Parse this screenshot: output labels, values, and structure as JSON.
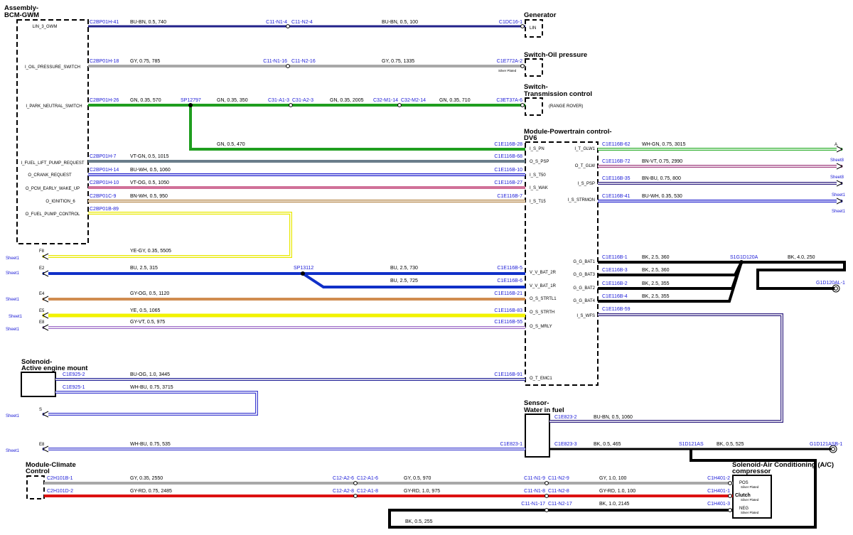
{
  "colors": {
    "BU-BN": "#22228a",
    "GY": "#a8a8a8",
    "GN": "#1f9e1f",
    "VT-GN": "#6a7d8a",
    "BU-WH": "#1a1acc",
    "VT-OG": "#d07098",
    "BN-WH": "#b08040",
    "YE-GY": "#e8e800",
    "BU": "#1030c8",
    "GY-OG": "#d08c50",
    "YE": "#f2f200",
    "GY-VT": "#a070c8",
    "BU-OG": "#2a2a9a",
    "WH-BU": "#4040d0",
    "GY-RD": "#dd1111",
    "BK": "#000000",
    "WH-GN": "#30b030",
    "BN-VT": "#a04080",
    "BN-BU": "#302080"
  },
  "components": {
    "bcm": "Assembly-\nBCM-GWM",
    "generator": "Generator",
    "oil": "Switch-Oil pressure",
    "trans": "Switch-\nTransmission control",
    "trans_note": "(RANGE ROVER)",
    "pcm": "Module-Powertrain control-\nDV6",
    "solenoid_mount": "Solenoid-\nActive engine mount",
    "sensor_wif": "Sensor-\nWater in fuel",
    "climate": "Module-Climate\nControl",
    "ac": "Solenoid-Air Conditioning (A/C)\ncompressor"
  },
  "bcm_pins": [
    "LIN_3_GWM",
    "I_OIL_PRESSURE_SWITCH",
    "I_PARK_NEUTRAL_SWITCH",
    "I_FUEL_LIFT_PUMP_REQUEST",
    "O_CRANK_REQUEST",
    "O_PCM_EARLY_WAKE_UP",
    "O_IGNITION_6",
    "O_FUEL_PUMP_CONTROL"
  ],
  "pcm_pins_left": [
    "I_S_PN",
    "O_S_PSP",
    "I_S_T50",
    "I_S_WAK",
    "I_S_T15",
    "V_V_BAT_2R",
    "V_V_BAT_1R",
    "O_S_STRTL1",
    "O_S_STRTH",
    "O_S_MRLY",
    "O_T_EMC1"
  ],
  "pcm_pins_right": [
    "I_T_GLW1",
    "O_T_GLW",
    "I_S_PSP",
    "I_S_STRMON",
    "G_G_BAT1",
    "G_G_BAT3",
    "G_G_BAT2",
    "G_G_BAT4",
    "I_S_WFS"
  ],
  "generator_pin": "LIN",
  "silver_plated": "Silver Plated",
  "ac_pins": [
    "POS",
    "Clutch",
    "NEG"
  ],
  "connectors": {
    "c1": "C2BP01H-41",
    "c2": "C11-N1-4",
    "c3": "C11-N2-4",
    "c4": "C1DC16-1",
    "c5": "C2BP01H-18",
    "c6": "C11-N1-16",
    "c7": "C11-N2-16",
    "c8": "C1E772A-2",
    "c9": "C2BP01H-26",
    "c10": "SP12797",
    "c11": "C31-A1-3",
    "c12": "C31-A2-3",
    "c13": "C32-M1-14",
    "c14": "C32-M2-14",
    "c15": "C3ET37A-6",
    "c16": "C1E116B-28",
    "c17": "C2BP01H-7",
    "c18": "C1E116B-68",
    "c19": "C2BP01H-14",
    "c20": "C1E116B-10",
    "c21": "C2BP01H-10",
    "c22": "C1E116B-27",
    "c23": "C2BP01C-9",
    "c24": "C1E116B-7",
    "c25": "C2BP01B-89",
    "c26": "SP13112",
    "c27": "C1E116B-5",
    "c28": "C1E116B-6",
    "c29": "C1E116B-21",
    "c30": "C1E116B-83",
    "c31": "C1E116B-55",
    "c32": "C1E925-2",
    "c33": "C1E116B-91",
    "c34": "C1E925-1",
    "c35": "C1E823-1",
    "c36": "C1E823-2",
    "c37": "C1E823-3",
    "c38": "S1D121AS",
    "c39": "G1D121ASB-1",
    "c40": "C1E116B-62",
    "c41": "C1E116B-72",
    "c42": "C1E116B-35",
    "c43": "C1E116B-41",
    "c44": "C1E116B-1",
    "c45": "C1E116B-3",
    "c46": "C1E116B-2",
    "c47": "C1E116B-4",
    "c48": "S1G1D120A",
    "c49": "G1D120AL-1",
    "c50": "C1E116B-59",
    "c51": "C2H101B-1",
    "c52": "C12-A2-6",
    "c53": "C12-A1-6",
    "c54": "C11-N1-9",
    "c55": "C11-N2-9",
    "c56": "C1H401-2",
    "c57": "C2H101D-2",
    "c58": "C12-A2-8",
    "c59": "C12-A1-8",
    "c60": "C11-N1-8",
    "c61": "C11-N2-8",
    "c62": "C1H401-1",
    "c63": "C11-N1-17",
    "c64": "C11-N2-17",
    "c65": "C1H401-3"
  },
  "wires": {
    "w1a": "BU-BN,  0.5,  740",
    "w1b": "BU-BN,  0.5,  100",
    "w2a": "GY,  0.75,  785",
    "w2b": "GY,  0.75,  1335",
    "w3a": "GN,  0.35,  570",
    "w3b": "GN,  0.35,  350",
    "w3c": "GN,  0.35,  2005",
    "w3d": "GN,  0.35,  710",
    "w3e": "GN,  0.5,  470",
    "w4": "VT-GN,  0.5,  1015",
    "w5": "BU-WH,  0.5,  1060",
    "w6": "VT-OG,  0.5,  1050",
    "w7": "BN-WH,  0.5,  950",
    "w8": "YE-GY,  0.35,  5505",
    "w9a": "BU,  2.5,  315",
    "w9b": "BU,  2.5,  730",
    "w9c": "BU,  2.5,  725",
    "w10": "GY-OG,  0.5,  1120",
    "w11": "YE,  0.5,  1065",
    "w12": "GY-VT,  0.5,  975",
    "w13": "BU-OG,  1.0,  3445",
    "w14": "WH-BU,  0.75,  3715",
    "w15": "WH-BU,  0.75,  535",
    "w16": "BU-BN,  0.5,  1060",
    "w17": "BK,  0.5,  465",
    "w18": "BK,  0.5,  525",
    "w19": "WH-GN,  0.75,  3015",
    "w20": "BN-VT,  0.75,  2990",
    "w21": "BN-BU,  0.75,  800",
    "w22": "BU-WH,  0.35,  530",
    "w23": "BK,  2.5,  360",
    "w24": "BK,  2.5,  360",
    "w25": "BK,  2.5,  355",
    "w26": "BK,  2.5,  355",
    "w27": "BK,  4.0,  250",
    "w28a": "GY,  0.35,  2550",
    "w28b": "GY,  0.5,  970",
    "w28c": "GY,  1.0,  100",
    "w29a": "GY-RD,  0.75,  2485",
    "w29b": "GY-RD,  1.0,  975",
    "w29c": "GY-RD,  1.0,  100",
    "w30": "BK,  1.0,  2145",
    "w31": "BK,  0.5,  255"
  },
  "edge_labels": [
    "F8",
    "E2",
    "E4",
    "E5",
    "E8",
    "S",
    "E8"
  ],
  "sheet_label": "Sheet1",
  "right_refs": [
    "A",
    "Sheet8",
    "Sheet8",
    "Sheet1",
    "Sheet1"
  ]
}
